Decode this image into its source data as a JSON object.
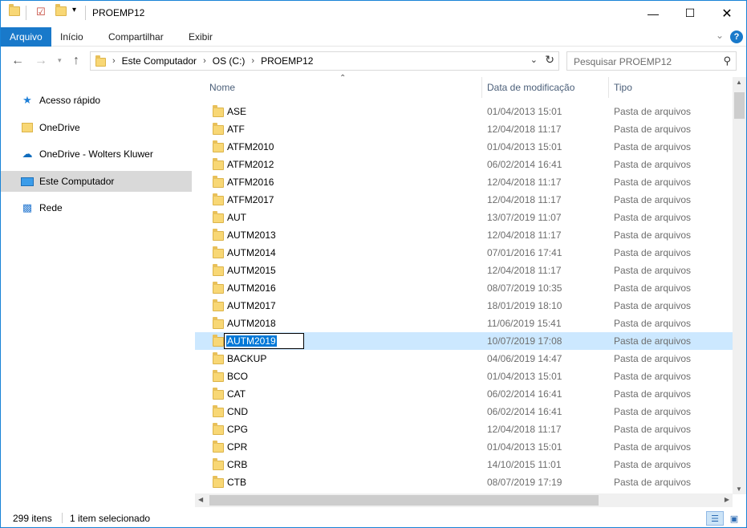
{
  "window": {
    "title": "PROEMP12"
  },
  "ribbon": {
    "tabs": [
      "Arquivo",
      "Início",
      "Compartilhar",
      "Exibir"
    ]
  },
  "address": {
    "crumbs": [
      "Este Computador",
      "OS (C:)",
      "PROEMP12"
    ],
    "search_placeholder": "Pesquisar PROEMP12"
  },
  "nav": {
    "items": [
      {
        "label": "Acesso rápido",
        "icon": "star-icon"
      },
      {
        "label": "OneDrive",
        "icon": "onedrive-folder-icon"
      },
      {
        "label": "OneDrive - Wolters Kluwer",
        "icon": "onedrive-cloud-icon"
      },
      {
        "label": "Este Computador",
        "icon": "computer-icon",
        "selected": true
      },
      {
        "label": "Rede",
        "icon": "network-icon"
      }
    ]
  },
  "columns": {
    "name": "Nome",
    "date": "Data de modificação",
    "type": "Tipo"
  },
  "files": [
    {
      "name": "ASE",
      "date": "01/04/2013 15:01",
      "type": "Pasta de arquivos"
    },
    {
      "name": "ATF",
      "date": "12/04/2018 11:17",
      "type": "Pasta de arquivos"
    },
    {
      "name": "ATFM2010",
      "date": "01/04/2013 15:01",
      "type": "Pasta de arquivos"
    },
    {
      "name": "ATFM2012",
      "date": "06/02/2014 16:41",
      "type": "Pasta de arquivos"
    },
    {
      "name": "ATFM2016",
      "date": "12/04/2018 11:17",
      "type": "Pasta de arquivos"
    },
    {
      "name": "ATFM2017",
      "date": "12/04/2018 11:17",
      "type": "Pasta de arquivos"
    },
    {
      "name": "AUT",
      "date": "13/07/2019 11:07",
      "type": "Pasta de arquivos"
    },
    {
      "name": "AUTM2013",
      "date": "12/04/2018 11:17",
      "type": "Pasta de arquivos"
    },
    {
      "name": "AUTM2014",
      "date": "07/01/2016 17:41",
      "type": "Pasta de arquivos"
    },
    {
      "name": "AUTM2015",
      "date": "12/04/2018 11:17",
      "type": "Pasta de arquivos"
    },
    {
      "name": "AUTM2016",
      "date": "08/07/2019 10:35",
      "type": "Pasta de arquivos"
    },
    {
      "name": "AUTM2017",
      "date": "18/01/2019 18:10",
      "type": "Pasta de arquivos"
    },
    {
      "name": "AUTM2018",
      "date": "11/06/2019 15:41",
      "type": "Pasta de arquivos"
    },
    {
      "name": "AUTM2019",
      "date": "10/07/2019 17:08",
      "type": "Pasta de arquivos",
      "selected": true,
      "renaming": true
    },
    {
      "name": "BACKUP",
      "date": "04/06/2019 14:47",
      "type": "Pasta de arquivos"
    },
    {
      "name": "BCO",
      "date": "01/04/2013 15:01",
      "type": "Pasta de arquivos"
    },
    {
      "name": "CAT",
      "date": "06/02/2014 16:41",
      "type": "Pasta de arquivos"
    },
    {
      "name": "CND",
      "date": "06/02/2014 16:41",
      "type": "Pasta de arquivos"
    },
    {
      "name": "CPG",
      "date": "12/04/2018 11:17",
      "type": "Pasta de arquivos"
    },
    {
      "name": "CPR",
      "date": "01/04/2013 15:01",
      "type": "Pasta de arquivos"
    },
    {
      "name": "CRB",
      "date": "14/10/2015 11:01",
      "type": "Pasta de arquivos"
    },
    {
      "name": "CTB",
      "date": "08/07/2019 17:19",
      "type": "Pasta de arquivos"
    }
  ],
  "status": {
    "count": "299 itens",
    "selection": "1 item selecionado"
  },
  "colors": {
    "accent": "#1979ca",
    "selection": "#cce8ff",
    "folder": "#f8d775"
  }
}
